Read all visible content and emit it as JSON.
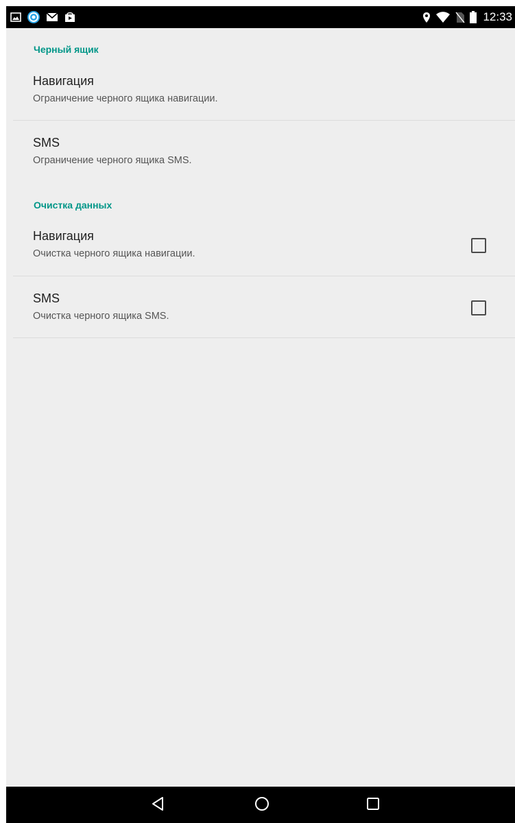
{
  "status_bar": {
    "time": "12:33",
    "left_icons": [
      "gallery-icon",
      "app-notification-icon",
      "email-icon",
      "store-icon"
    ],
    "right_icons": [
      "location-icon",
      "wifi-icon",
      "no-sim-icon",
      "battery-icon"
    ]
  },
  "sections": [
    {
      "header": "Черный ящик",
      "items": [
        {
          "title": "Навигация",
          "summary": "Ограничение черного ящика навигации.",
          "has_checkbox": false
        },
        {
          "title": "SMS",
          "summary": "Ограничение черного ящика SMS.",
          "has_checkbox": false
        }
      ]
    },
    {
      "header": "Очистка данных",
      "items": [
        {
          "title": "Навигация",
          "summary": "Очистка черного ящика навигации.",
          "has_checkbox": true,
          "checked": false
        },
        {
          "title": "SMS",
          "summary": "Очистка черного ящика SMS.",
          "has_checkbox": true,
          "checked": false
        }
      ]
    }
  ],
  "nav_bar": {
    "buttons": [
      "back-icon",
      "home-icon",
      "recents-icon"
    ]
  },
  "colors": {
    "accent": "#009688",
    "background": "#eeeeee",
    "bars": "#000000"
  }
}
